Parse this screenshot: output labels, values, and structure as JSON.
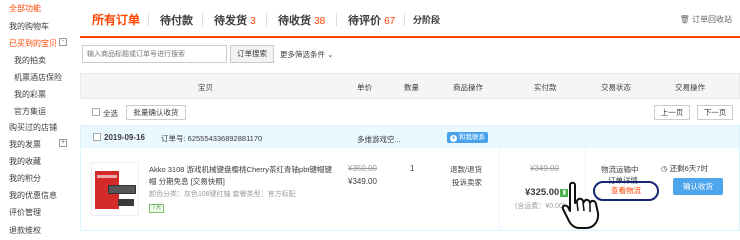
{
  "sidebar": {
    "items": [
      {
        "label": "全部功能",
        "orange": true,
        "sub": false
      },
      {
        "label": "我的购物车",
        "orange": false,
        "sub": false
      },
      {
        "label": "已买到的宝贝",
        "orange": true,
        "sub": false,
        "toggle": "-"
      },
      {
        "label": "我的拍卖",
        "orange": false,
        "sub": true
      },
      {
        "label": "机票酒店保险",
        "orange": false,
        "sub": true
      },
      {
        "label": "我的彩票",
        "orange": false,
        "sub": true
      },
      {
        "label": "官方集运",
        "orange": false,
        "sub": true
      },
      {
        "label": "购买过的店铺",
        "orange": false,
        "sub": false
      },
      {
        "label": "我的发票",
        "orange": false,
        "sub": false,
        "toggle": "+"
      },
      {
        "label": "我的收藏",
        "orange": false,
        "sub": false
      },
      {
        "label": "我的积分",
        "orange": false,
        "sub": false
      },
      {
        "label": "我的优惠信息",
        "orange": false,
        "sub": false
      },
      {
        "label": "评价管理",
        "orange": false,
        "sub": false
      },
      {
        "label": "退款维权",
        "orange": false,
        "sub": false
      }
    ]
  },
  "tabs": [
    {
      "label": "所有订单",
      "count": ""
    },
    {
      "label": "待付款",
      "count": ""
    },
    {
      "label": "待发货",
      "count": "3"
    },
    {
      "label": "待收货",
      "count": "38"
    },
    {
      "label": "待评价",
      "count": "67"
    },
    {
      "label": "分阶段",
      "count": ""
    }
  ],
  "recycle_label": "订单回收站",
  "search": {
    "placeholder": "输入商品标题或订单号进行搜索",
    "button": "订单搜索",
    "more": "更多筛选条件"
  },
  "table_headers": [
    "宝贝",
    "单价",
    "数量",
    "商品操作",
    "实付款",
    "交易状态",
    "交易操作"
  ],
  "bulk": {
    "select_all": "全选",
    "confirm_btn": "批量确认收货",
    "prev": "上一页",
    "next": "下一页"
  },
  "order": {
    "date": "2019-09-16",
    "order_no": "订单号: 625554336892881170",
    "shop": "多维游戏空...",
    "badge": "和我联系",
    "product": {
      "title": "Akko 3108 游戏机械键盘樱桃Cherry茶红青轴pbt键帽键帽 分期免息",
      "tag": "[交易快照]",
      "attrs": "颜色分类：灰色108键红轴  套餐类型：官方标配",
      "service_icon": "7天"
    },
    "unit_price_original": "¥350.00",
    "unit_price": "¥349.00",
    "quantity": "1",
    "ops": [
      "退款/退货",
      "投诉卖家"
    ],
    "paid_original": "¥349.00",
    "paid": "¥325.00",
    "freight": "(含运费：¥0.00)",
    "status": [
      "物流运输中",
      "订单详情"
    ],
    "logistics_btn": "查看物流",
    "remain": "还剩6天7时",
    "confirm_btn": "确认收货"
  },
  "colors": {
    "accent": "#ff4400",
    "button_blue": "#4da5ec",
    "order_head_bg": "#eaf8ff",
    "highlight_ring": "#152873"
  }
}
